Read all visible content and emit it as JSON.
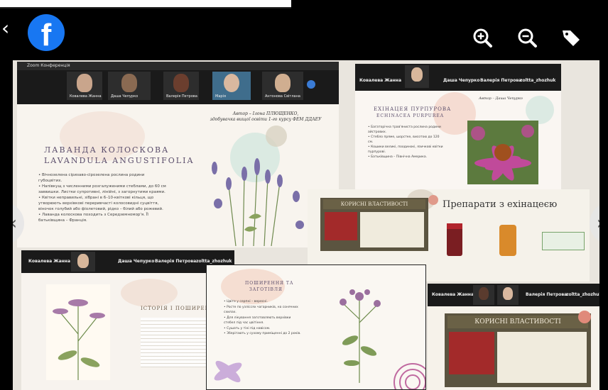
{
  "viewer": {
    "icons": {
      "close": "close-icon",
      "brand": "facebook-logo",
      "zoom_in": "zoom-in-icon",
      "zoom_out": "zoom-out-icon",
      "tag": "tag-icon",
      "prev": "chevron-left-icon",
      "next": "chevron-right-icon"
    },
    "brand_letter": "f",
    "brand_color": "#1877f2"
  },
  "lavender": {
    "window_title": "Zoom Конференція",
    "participants": [
      "Ковалева Жанна",
      "Даша Чепурко",
      "Валерія Петрова",
      "Марія",
      "Антонова Світлана"
    ],
    "author_line1": "Автор – Ілона ПЛЮЩЕНКО,",
    "author_line2": "здобувачка вищої освіти 1-го курсу ФЕМ ДДАЕУ",
    "title_line1": "ЛАВАНДА КОЛОСКОВА",
    "title_line2": "LAVANDULA ANGUSTIFOLIA",
    "bullets": [
      "Вічнозелена сіризаво-сірозелена рослина родини губоцвітих.",
      "Напівкущ з численними розгалуженими стеблами, до 60 см заввишки. Листки супротивні, лінійні, з загорнутими краями.",
      "Квітки неправильні, зібрані в 6–10-квіткові кільця, що утворюють верхівкові переривчасті колосовидні суцвіття, віночок голубий або фіолетовий, рідко – білий або рожевий.",
      "Лаванда колоскова походить з Середземномор'я. Її батьківщина – Франція."
    ]
  },
  "echinacea": {
    "participants": [
      "Ковалева Жанна",
      "Даша Чепурко",
      "Валерія Петрова",
      "zoltta_zhozhuk"
    ],
    "slide_title_line1": "ЕХІНАЦЕЯ ПУРПУРОВА",
    "slide_title_line2": "ECHINACEA PURPUREA",
    "author": "Автор – Даша Чепурко",
    "bullets": [
      "Багаторічна трав'яниста рослина родини айстрових.",
      "Стебло пряме, шорстке, висотою до 120 см.",
      "Кошики великі, поодинокі, язичкові квітки пурпурові.",
      "Батьківщина – Північна Америка."
    ]
  },
  "preparations": {
    "banner": "КОРИСНІ ВЛАСТИВОСТІ",
    "title": "Препарати з ехінацеєю"
  },
  "history": {
    "participants": [
      "Ковалева Жанна",
      "Даша Чепурко",
      "Валерія Петрова",
      "zoltta_zhozhuk"
    ],
    "title": "ІСТОРІЯ І ПОШИРЕННЯ"
  },
  "distribution": {
    "title_line1": "ПОШИРЕННЯ ТА",
    "title_line2": "ЗАГОТІВЛЯ",
    "bullets": [
      "Цвіте у серпні – вересні.",
      "Росте по узліссях чагарників, на сонячних схилах.",
      "Для лікування заготовляють верхівки стебел під час цвітіння.",
      "Сушать у тіні під навісом.",
      "Зберігають у сухому приміщенні до 2 років."
    ]
  },
  "benefits": {
    "participants": [
      "Ковалева Жанна",
      "Валерія Петрова",
      "zoltta_zhozhuk"
    ],
    "banner": "КОРИСНІ ВЛАСТИВОСТІ"
  },
  "colors": {
    "accent": "#5a4d6b",
    "banner": "#6a6146",
    "petal": "#b0448e"
  }
}
